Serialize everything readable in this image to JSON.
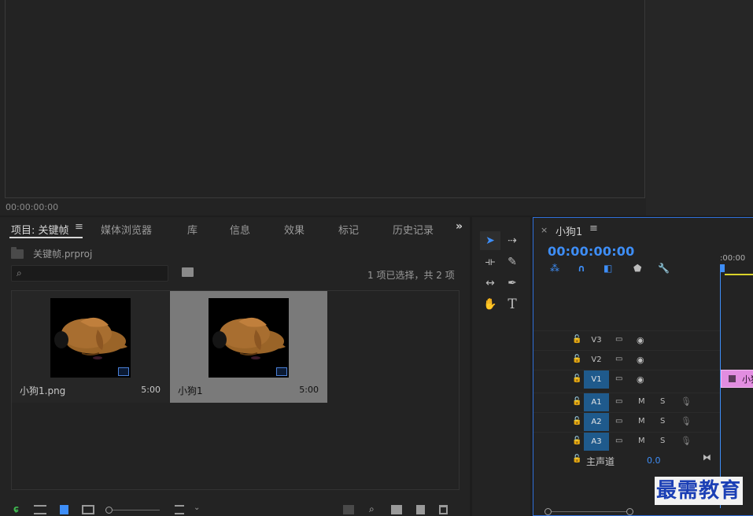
{
  "monitor": {
    "timecode": "00:00:00:00"
  },
  "project_panel": {
    "tabs": [
      {
        "label": "项目: 关键帧"
      },
      {
        "label": "媒体浏览器"
      },
      {
        "label": "库"
      },
      {
        "label": "信息"
      },
      {
        "label": "效果"
      },
      {
        "label": "标记"
      },
      {
        "label": "历史记录"
      }
    ],
    "menu_glyph": "≡",
    "more_glyph": "»",
    "project_file": "关键帧.prproj",
    "search": {
      "value": "",
      "placeholder": ""
    },
    "item_count": "1 项已选择，共 2 项",
    "items": [
      {
        "name": "小狗1.png",
        "duration": "5:00",
        "selected": false,
        "badge": "image-icon"
      },
      {
        "name": "小狗1",
        "duration": "5:00",
        "selected": true,
        "badge": "sequence-icon"
      }
    ]
  },
  "timeline": {
    "close_glyph": "×",
    "title": "小狗1",
    "menu_glyph": "≡",
    "timecode": "00:00:00:00",
    "ruler_label": ":00:00",
    "tracks": [
      {
        "name": "V3",
        "type": "video",
        "active": false
      },
      {
        "name": "V2",
        "type": "video",
        "active": false
      },
      {
        "name": "V1",
        "type": "video",
        "active": true
      },
      {
        "name": "A1",
        "type": "audio",
        "active": true
      },
      {
        "name": "A2",
        "type": "audio",
        "active": true
      },
      {
        "name": "A3",
        "type": "audio",
        "active": true
      }
    ],
    "audio_buttons": {
      "mute": "M",
      "solo": "S"
    },
    "master": {
      "label": "主声道",
      "value": "0.0"
    },
    "clip_v1_label": "小狗",
    "accent": "#3e8ef7",
    "clip_color": "#e28de0"
  },
  "watermark": "最需教育"
}
